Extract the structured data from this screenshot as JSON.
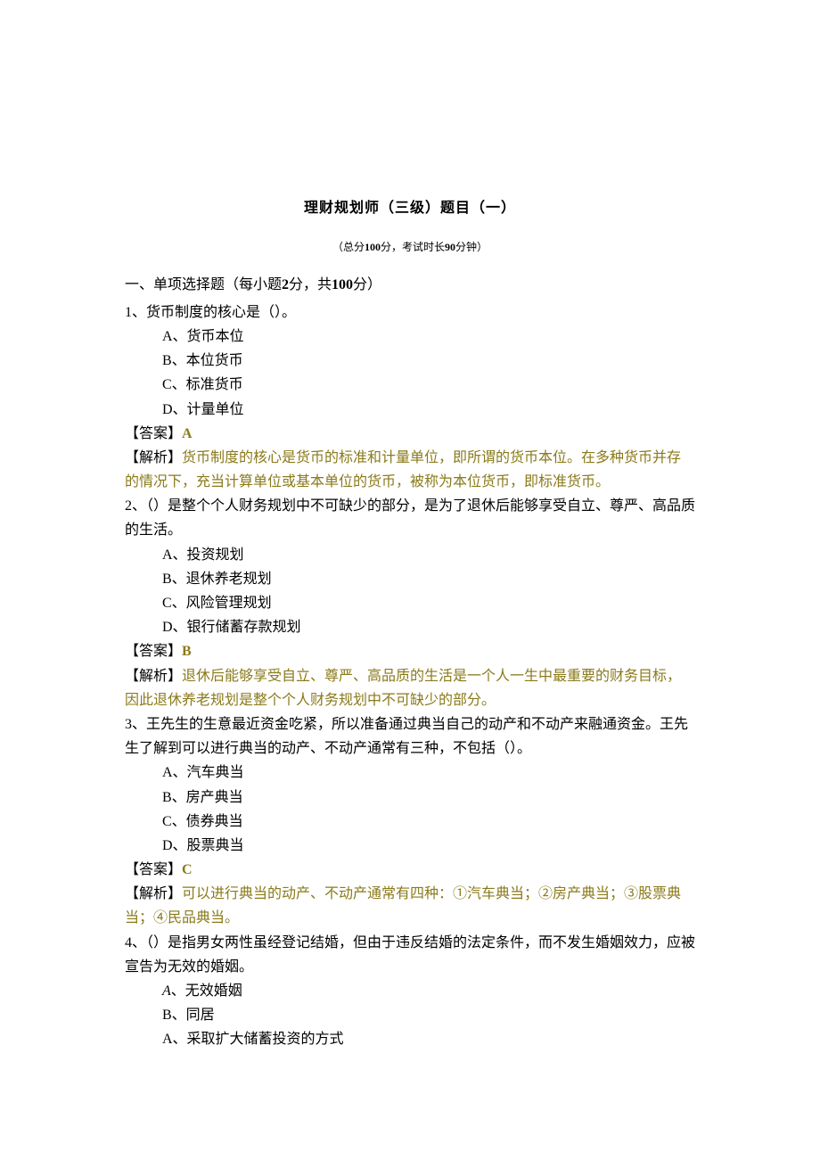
{
  "title": "理财规划师（三级）题目（一）",
  "subnote": {
    "prefix": "（总分",
    "total_score": "100",
    "mid1": "分，考试时长",
    "duration": "90",
    "suffix": "分钟）"
  },
  "section": {
    "label": "一、单项选择题（每小题",
    "per_score": "2",
    "mid": "分，共",
    "sum_score": "100",
    "suffix": "分）"
  },
  "questions": [
    {
      "num": "1",
      "stem": "、货币制度的核心是（）。",
      "options": [
        "A、货币本位",
        "B、本位货币",
        "C、标准货币",
        "D、计量单位"
      ],
      "answer_label": "【答案】",
      "answer": "A",
      "explain_label": "【解析】",
      "explain": "货币制度的核心是货币的标准和计量单位，即所谓的货币本位。在多种货币并存的情况下，充当计算单位或基本单位的货币，被称为本位货币，即标准货币。"
    },
    {
      "num": "2",
      "stem": "、（）是整个个人财务规划中不可缺少的部分，是为了退休后能够享受自立、尊严、高品质的生活。",
      "options": [
        "A、投资规划",
        "B、退休养老规划",
        "C、风险管理规划",
        "D、银行储蓄存款规划"
      ],
      "answer_label": "【答案】",
      "answer": "B",
      "explain_label": "【解析】",
      "explain": "退休后能够享受自立、尊严、高品质的生活是一个人一生中最重要的财务目标，因此退休养老规划是整个个人财务规划中不可缺少的部分。"
    },
    {
      "num": "3",
      "stem": "、王先生的生意最近资金吃紧，所以准备通过典当自己的动产和不动产来融通资金。王先生了解到可以进行典当的动产、不动产通常有三种，不包括（）。",
      "options": [
        "A、汽车典当",
        "B、房产典当",
        "C、债券典当",
        "D、股票典当"
      ],
      "answer_label": "【答案】",
      "answer": "C",
      "explain_label": "【解析】",
      "explain": "可以进行典当的动产、不动产通常有四种：①汽车典当；②房产典当；③股票典当；④民品典当。"
    },
    {
      "num": "4",
      "stem": "、（）是指男女两性虽经登记结婚，但由于违反结婚的法定条件，而不发生婚姻效力，应被宣告为无效的婚姻。",
      "options": [
        "A、无效婚姻",
        "B、同居",
        "A、采取扩大储蓄投资的方式"
      ]
    }
  ]
}
